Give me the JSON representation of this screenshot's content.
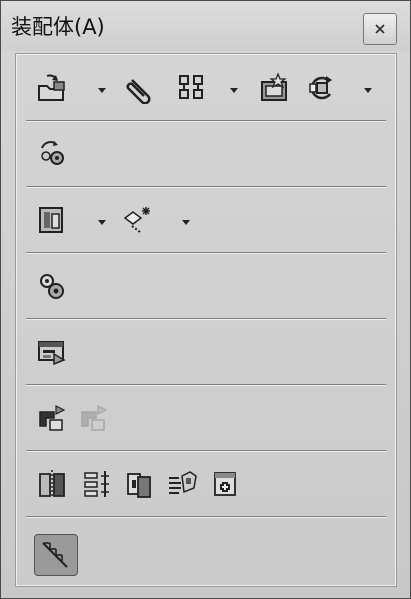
{
  "window": {
    "title": "装配体(A)",
    "close_icon": "close-icon"
  },
  "toolbar": {
    "rows": [
      [
        "insert-components-icon",
        "mate-icon",
        "linear-pattern-icon",
        "smart-fasteners-icon",
        "move-component-icon"
      ],
      [
        "assembly-features-icon"
      ],
      [
        "explode-view-icon",
        "explode-line-sketch-icon"
      ],
      [
        "interference-detection-icon"
      ],
      [
        "assembly-visualization-icon"
      ],
      [
        "show-hidden-components-icon",
        "hidden-components-disabled-icon"
      ],
      [
        "mirror-components-icon",
        "distribute-icon",
        "copy-with-mates-icon",
        "belt-chain-icon",
        "new-part-icon"
      ],
      [
        "sketch-active-icon"
      ]
    ]
  },
  "colors": {
    "window_bg": "#d3d3d3",
    "separator": "#7f7f7f",
    "active_button": "#9a9a9a"
  }
}
